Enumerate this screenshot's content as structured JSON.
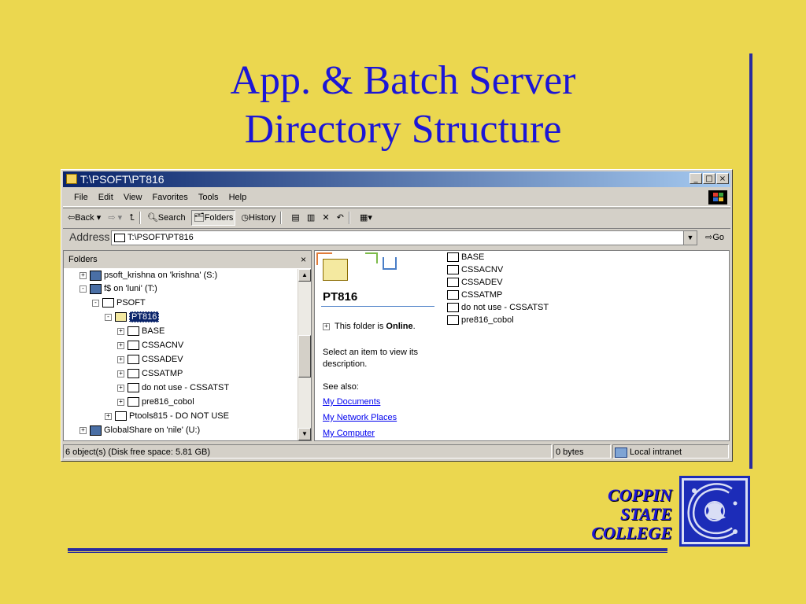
{
  "slide": {
    "title_line1": "App. & Batch Server",
    "title_line2": "Directory Structure"
  },
  "window": {
    "title": "T:\\PSOFT\\PT816",
    "title_buttons": [
      "_",
      "□",
      "×"
    ],
    "menu": [
      "File",
      "Edit",
      "View",
      "Favorites",
      "Tools",
      "Help"
    ],
    "toolbar": {
      "back": "Back",
      "search": "Search",
      "folders": "Folders",
      "history": "History"
    },
    "address": {
      "label": "Address",
      "value": "T:\\PSOFT\\PT816",
      "go": "Go"
    },
    "folders_pane": {
      "header": "Folders",
      "close": "×",
      "items": [
        {
          "label": "psoft_krishna on 'krishna' (S:)",
          "type": "net",
          "pm": "+"
        },
        {
          "label": "f$ on 'luni' (T:)",
          "type": "net",
          "pm": "-"
        },
        {
          "label": "PSOFT",
          "type": "folder",
          "pm": "-"
        },
        {
          "label": "PT816",
          "type": "folder",
          "pm": "-"
        },
        {
          "label": "BASE",
          "type": "folder",
          "pm": "+"
        },
        {
          "label": "CSSACNV",
          "type": "folder",
          "pm": "+"
        },
        {
          "label": "CSSADEV",
          "type": "folder",
          "pm": "+"
        },
        {
          "label": "CSSATMP",
          "type": "folder",
          "pm": "+"
        },
        {
          "label": "do not use - CSSATST",
          "type": "folder",
          "pm": "+"
        },
        {
          "label": "pre816_cobol",
          "type": "folder",
          "pm": "+"
        },
        {
          "label": "Ptools815 - DO NOT USE",
          "type": "folder",
          "pm": "+"
        },
        {
          "label": "GlobalShare on 'nile' (U:)",
          "type": "net",
          "pm": "+"
        }
      ]
    },
    "web_view": {
      "folder_name": "PT816",
      "online_prefix": "This folder is ",
      "online_state": "Online",
      "online_suffix": ".",
      "description": "Select an item to view its description.",
      "see_also": "See also:",
      "links": [
        "My Documents",
        "My Network Places",
        "My Computer"
      ]
    },
    "files": [
      "BASE",
      "CSSACNV",
      "CSSADEV",
      "CSSATMP",
      "do not use - CSSATST",
      "pre816_cobol"
    ],
    "status": {
      "objects": "6 object(s) (Disk free space: 5.81 GB)",
      "size": "0 bytes",
      "zone": "Local intranet"
    }
  },
  "logo": {
    "line1": "COPPIN",
    "line2": "STATE",
    "line3": "COLLEGE"
  },
  "colors": {
    "background": "#EBD74F",
    "title": "#1C16D6",
    "rule": "#2A2C9E",
    "titlebar_start": "#0A246A",
    "titlebar_end": "#A6CAF0"
  }
}
